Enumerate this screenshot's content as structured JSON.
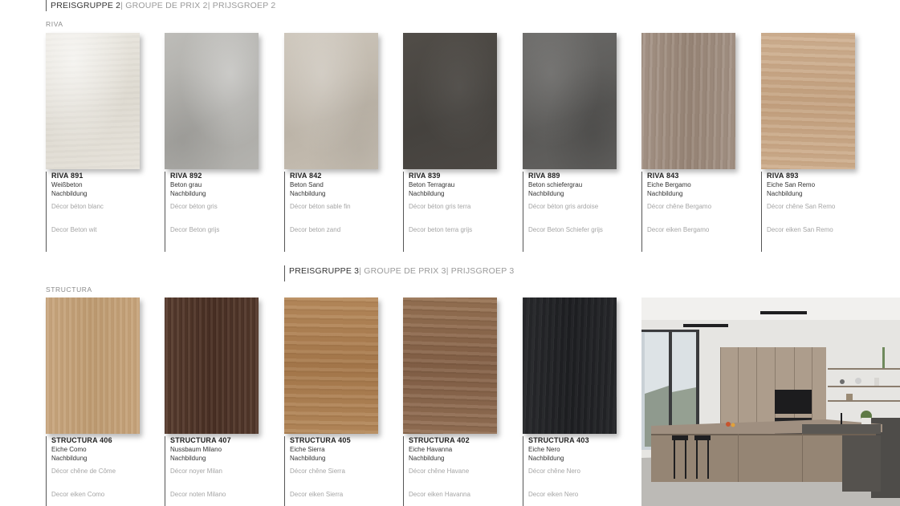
{
  "group2": {
    "main": "PREISGRUPPE 2",
    "fr": "GROUPE DE PRIX 2",
    "nl": "PRIJSGROEP 2"
  },
  "group3": {
    "main": "PREISGRUPPE 3",
    "fr": "GROUPE DE PRIX 3",
    "nl": "PRIJSGROEP 3"
  },
  "series_riva": "RIVA",
  "series_structura": "STRUCTURA",
  "separator": "|",
  "riva": [
    {
      "code": "RIVA 891",
      "name": "Weißbeton",
      "note": "Nachbildung",
      "fr": "Décor béton blanc",
      "nl": "Decor Beton wit"
    },
    {
      "code": "RIVA 892",
      "name": "Beton grau",
      "note": "Nachbildung",
      "fr": "Décor béton gris",
      "nl": "Decor Beton grijs"
    },
    {
      "code": "RIVA 842",
      "name": "Beton Sand",
      "note": "Nachbildung",
      "fr": "Décor béton sable fin",
      "nl": "Decor beton zand"
    },
    {
      "code": "RIVA 839",
      "name": "Beton Terragrau",
      "note": "Nachbildung",
      "fr": "Décor béton gris terra",
      "nl": "Decor beton terra grijs"
    },
    {
      "code": "RIVA 889",
      "name": "Beton schiefergrau",
      "note": "Nachbildung",
      "fr": "Décor béton gris ardoise",
      "nl": "Decor Beton Schiefer grijs"
    },
    {
      "code": "RIVA 843",
      "name": "Eiche Bergamo",
      "note": "Nachbildung",
      "fr": "Décor chêne Bergamo",
      "nl": "Decor eiken Bergamo"
    },
    {
      "code": "RIVA 893",
      "name": "Eiche San Remo",
      "note": "Nachbildung",
      "fr": "Décor chêne San Remo",
      "nl": "Decor eiken San Remo"
    }
  ],
  "structura": [
    {
      "code": "STRUCTURA 406",
      "name": "Eiche Como",
      "note": "Nachbildung",
      "fr": "Décor chêne de Côme",
      "nl": "Decor eiken Como"
    },
    {
      "code": "STRUCTURA 407",
      "name": "Nussbaum Milano",
      "note": "Nachbildung",
      "fr": "Décor noyer Milan",
      "nl": "Decor noten Milano"
    },
    {
      "code": "STRUCTURA 405",
      "name": "Eiche Sierra",
      "note": "Nachbildung",
      "fr": "Décor chêne Sierra",
      "nl": "Decor eiken Sierra"
    },
    {
      "code": "STRUCTURA 402",
      "name": "Eiche Havanna",
      "note": "Nachbildung",
      "fr": "Décor chêne Havane",
      "nl": "Decor eiken Havanna"
    },
    {
      "code": "STRUCTURA 403",
      "name": "Eiche Nero",
      "note": "Nachbildung",
      "fr": "Décor chêne Nero",
      "nl": "Decor eiken Nero"
    }
  ]
}
